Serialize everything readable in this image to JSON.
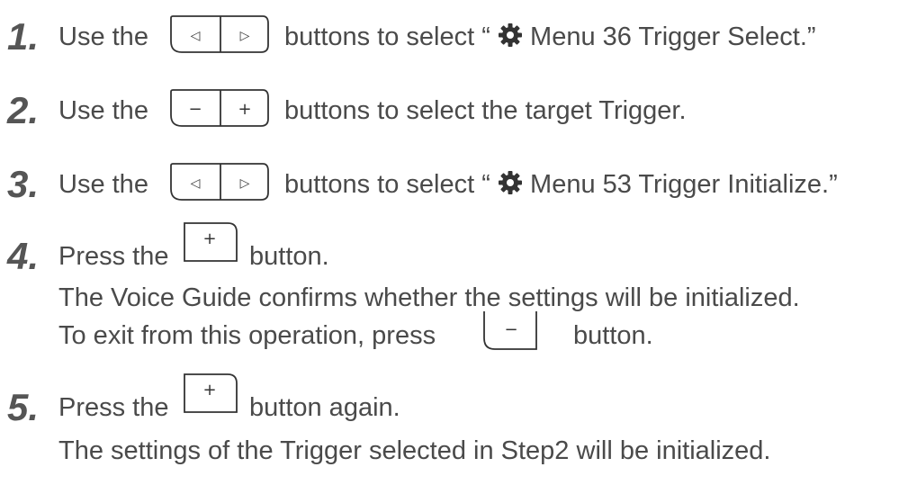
{
  "steps": [
    {
      "number": "1.",
      "before": "Use the",
      "after_prefix": "buttons to select “",
      "menu_text": "Menu 36 Trigger Select.”",
      "buttons": [
        "left-arrow",
        "right-arrow"
      ]
    },
    {
      "number": "2.",
      "before": "Use the",
      "after": "buttons to select the target Trigger.",
      "buttons": [
        "minus",
        "plus"
      ]
    },
    {
      "number": "3.",
      "before": "Use the",
      "after_prefix": "buttons to select “",
      "menu_text": "Menu 53 Trigger Initialize.”",
      "buttons": [
        "left-arrow",
        "right-arrow"
      ]
    },
    {
      "number": "4.",
      "before": "Press the",
      "after": "button.",
      "line2": "The Voice Guide confirms whether the settings will be initialized.",
      "line3_before": "To exit from this operation, press",
      "line3_after": "button.",
      "buttons": [
        "plus"
      ]
    },
    {
      "number": "5.",
      "before": "Press the",
      "after": "button again.",
      "line2": "The settings of the Trigger selected in Step2 will be initialized.",
      "buttons": [
        "plus"
      ]
    }
  ],
  "glyphs": {
    "left": "◁",
    "right": "▷",
    "minus": "−",
    "plus": "+"
  },
  "icons": {
    "gear": "gear-icon",
    "left_arrow": "left-arrow-icon",
    "right_arrow": "right-arrow-icon",
    "minus": "minus-icon",
    "plus": "plus-icon"
  },
  "colors": {
    "text": "#4a4a4a",
    "number": "#555555",
    "button_outline": "#333333"
  }
}
